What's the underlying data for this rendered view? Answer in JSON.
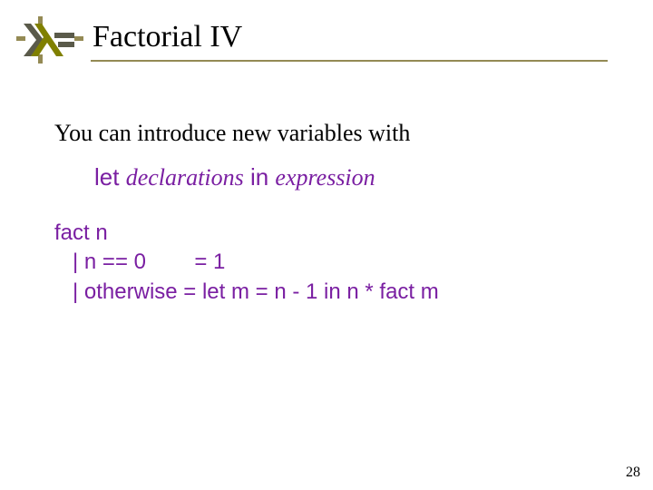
{
  "title": "Factorial IV",
  "intro": "You can introduce new variables with",
  "letline": {
    "let": "let",
    "declarations": "declarations",
    "in": "in",
    "expression": "expression"
  },
  "code": {
    "l1": "fact n",
    "l2": "   | n == 0        = 1",
    "l3": "   | otherwise = let m = n - 1 in n * fact m"
  },
  "page": "28",
  "colors": {
    "accent": "#948a54",
    "keyword": "#7a1fa2"
  }
}
